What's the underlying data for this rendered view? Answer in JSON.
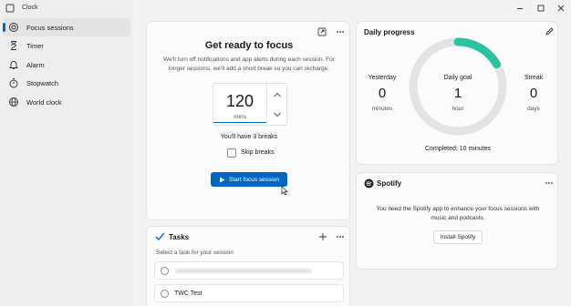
{
  "app": {
    "title": "Clock"
  },
  "sidebar": {
    "items": [
      {
        "label": "Focus sessions",
        "icon": "focus-icon",
        "active": true
      },
      {
        "label": "Timer",
        "icon": "hourglass-icon"
      },
      {
        "label": "Alarm",
        "icon": "bell-icon"
      },
      {
        "label": "Stopwatch",
        "icon": "stopwatch-icon"
      },
      {
        "label": "World clock",
        "icon": "globe-icon"
      }
    ]
  },
  "focus": {
    "heading": "Get ready to focus",
    "description": "We'll turn off notifications and app alerts during each session. For longer sessions, we'll add a short break so you can recharge.",
    "duration_value": "120",
    "duration_unit": "mins",
    "breaks_text": "You'll have 3 breaks",
    "skip_breaks_label": "Skip breaks",
    "skip_breaks_checked": false,
    "start_button": "Start focus session"
  },
  "progress": {
    "title": "Daily progress",
    "yesterday_label": "Yesterday",
    "yesterday_value": "0",
    "yesterday_unit": "minutes",
    "goal_label": "Daily goal",
    "goal_value": "1",
    "goal_unit": "hour",
    "streak_label": "Streak",
    "streak_value": "0",
    "streak_unit": "days",
    "completed_text": "Completed: 10 minutes",
    "goal_fraction": 0.167,
    "accent_color": "#2cc3a0"
  },
  "spotify": {
    "title": "Spotify",
    "description": "You need the Spotify app to enhance your focus sessions with music and podcasts.",
    "install_button": "Install Spotify"
  },
  "tasks": {
    "title": "Tasks",
    "subtitle": "Select a task for your session",
    "items": [
      {
        "label": "",
        "blurred": true
      },
      {
        "label": "TWC Test",
        "blurred": false
      }
    ]
  },
  "colors": {
    "accent": "#0067c0",
    "progress": "#2cc3a0"
  }
}
